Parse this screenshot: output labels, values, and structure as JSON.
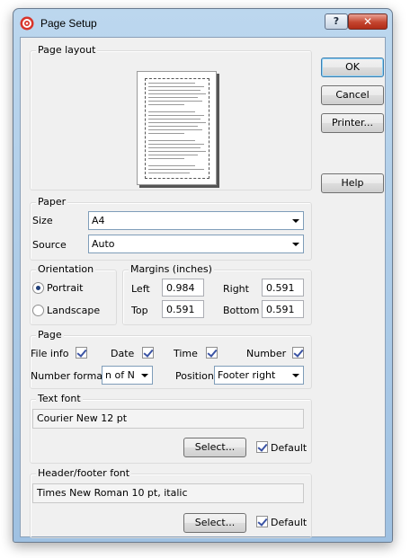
{
  "window": {
    "title": "Page Setup",
    "help_glyph": "?",
    "close_glyph": "✕"
  },
  "buttons": {
    "ok": "OK",
    "cancel": "Cancel",
    "printer": "Printer...",
    "help": "Help"
  },
  "page_layout": {
    "label": "Page layout"
  },
  "paper": {
    "label": "Paper",
    "size_label": "Size",
    "size_value": "A4",
    "source_label": "Source",
    "source_value": "Auto"
  },
  "orientation": {
    "label": "Orientation",
    "portrait": "Portrait",
    "landscape": "Landscape",
    "selected": "Portrait"
  },
  "margins": {
    "label": "Margins (inches)",
    "left_label": "Left",
    "left_value": "0.984",
    "right_label": "Right",
    "right_value": "0.591",
    "top_label": "Top",
    "top_value": "0.591",
    "bottom_label": "Bottom",
    "bottom_value": "0.591"
  },
  "page": {
    "label": "Page",
    "file_info": "File info",
    "date": "Date",
    "time": "Time",
    "number": "Number",
    "number_format_label": "Number format",
    "number_format_value": "n of N",
    "position_label": "Position",
    "position_value": "Footer right"
  },
  "text_font": {
    "label": "Text font",
    "value": "Courier New 12 pt",
    "select": "Select...",
    "default": "Default"
  },
  "header_footer_font": {
    "label": "Header/footer font",
    "value": "Times New Roman 10 pt, italic",
    "select": "Select...",
    "default": "Default"
  },
  "colors": {
    "accent": "#3c7fb1",
    "title_bar": "#bcd7ee",
    "dialog_bg": "#f0f0f0"
  }
}
